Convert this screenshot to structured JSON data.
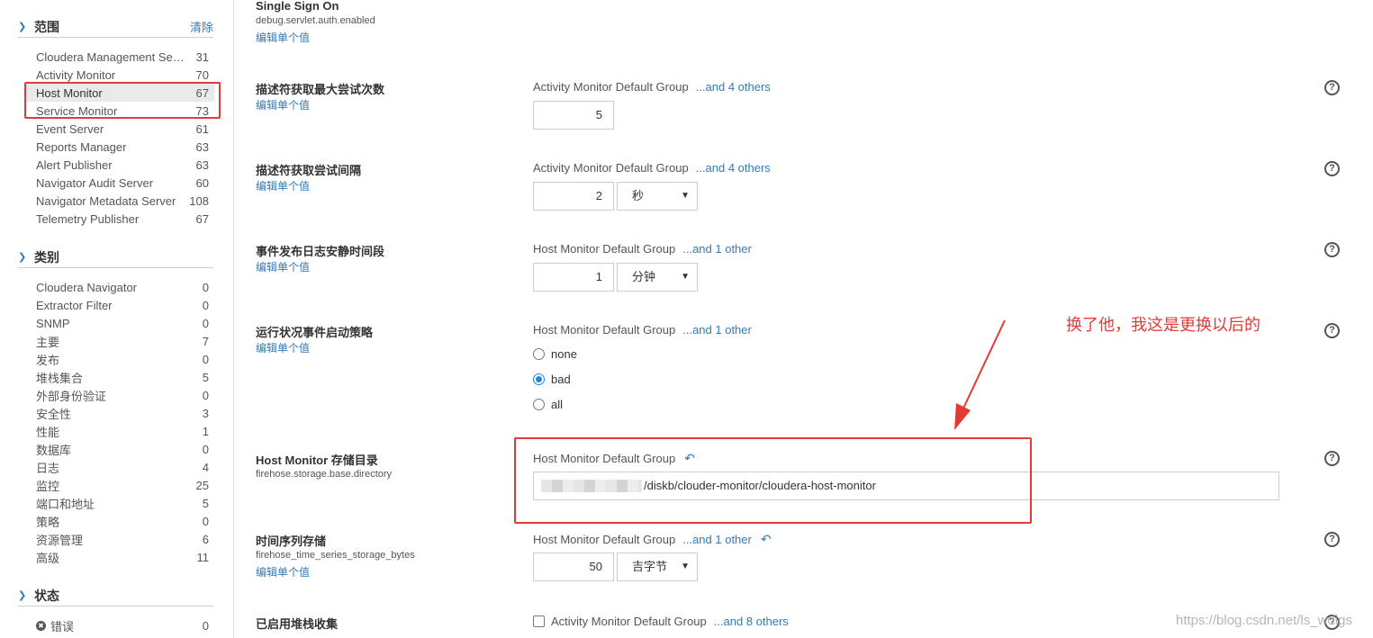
{
  "sidebar": {
    "scope": {
      "title": "范围",
      "clear": "清除",
      "items": [
        {
          "label": "Cloudera Management Servi...",
          "count": "31"
        },
        {
          "label": "Activity Monitor",
          "count": "70"
        },
        {
          "label": "Host Monitor",
          "count": "67",
          "selected": true
        },
        {
          "label": "Service Monitor",
          "count": "73"
        },
        {
          "label": "Event Server",
          "count": "61"
        },
        {
          "label": "Reports Manager",
          "count": "63"
        },
        {
          "label": "Alert Publisher",
          "count": "63"
        },
        {
          "label": "Navigator Audit Server",
          "count": "60"
        },
        {
          "label": "Navigator Metadata Server",
          "count": "108"
        },
        {
          "label": "Telemetry Publisher",
          "count": "67"
        }
      ]
    },
    "category": {
      "title": "类别",
      "items": [
        {
          "label": "Cloudera Navigator",
          "count": "0"
        },
        {
          "label": "Extractor Filter",
          "count": "0"
        },
        {
          "label": "SNMP",
          "count": "0"
        },
        {
          "label": "主要",
          "count": "7"
        },
        {
          "label": "发布",
          "count": "0"
        },
        {
          "label": "堆栈集合",
          "count": "5"
        },
        {
          "label": "外部身份验证",
          "count": "0"
        },
        {
          "label": "安全性",
          "count": "3"
        },
        {
          "label": "性能",
          "count": "1"
        },
        {
          "label": "数据库",
          "count": "0"
        },
        {
          "label": "日志",
          "count": "4"
        },
        {
          "label": "监控",
          "count": "25"
        },
        {
          "label": "端口和地址",
          "count": "5"
        },
        {
          "label": "策略",
          "count": "0"
        },
        {
          "label": "资源管理",
          "count": "6"
        },
        {
          "label": "高级",
          "count": "11"
        }
      ]
    },
    "status": {
      "title": "状态",
      "items": [
        {
          "label": "错误",
          "count": "0",
          "icon": "error-icon"
        }
      ]
    }
  },
  "main": {
    "edit_label": "编辑单个值",
    "rows": [
      {
        "name": "Single Sign On",
        "key": "debug.servlet.auth.enabled"
      },
      {
        "name": "描述符获取最大尝试次数",
        "group": "Activity Monitor Default Group",
        "others": "...and 4 others",
        "value": "5"
      },
      {
        "name": "描述符获取尝试间隔",
        "group": "Activity Monitor Default Group",
        "others": "...and 4 others",
        "value": "2",
        "unit": "秒"
      },
      {
        "name": "事件发布日志安静时间段",
        "group": "Host Monitor Default Group",
        "others": "...and 1 other",
        "value": "1",
        "unit": "分钟"
      },
      {
        "name": "运行状况事件启动策略",
        "group": "Host Monitor Default Group",
        "others": "...and 1 other",
        "options": [
          "none",
          "bad",
          "all"
        ],
        "selected": "bad"
      },
      {
        "name": "Host Monitor 存储目录",
        "key": "firehose.storage.base.directory",
        "group": "Host Monitor Default Group",
        "value": "/diskb/clouder-monitor/cloudera-host-monitor"
      },
      {
        "name": "时间序列存储",
        "key": "firehose_time_series_storage_bytes",
        "group": "Host Monitor Default Group",
        "others": "...and 1 other",
        "value": "50",
        "unit": "吉字节"
      },
      {
        "name": "已启用堆栈收集",
        "group": "Activity Monitor Default Group",
        "others": "...and 8 others"
      }
    ]
  },
  "annotation": {
    "text": "换了他，我这是更换以后的",
    "color": "#e53935"
  },
  "watermark": "https://blog.csdn.net/ls_wdigs",
  "colors": {
    "link": "#337ab7",
    "accent": "#1e88e5",
    "annotation": "#e53935"
  }
}
